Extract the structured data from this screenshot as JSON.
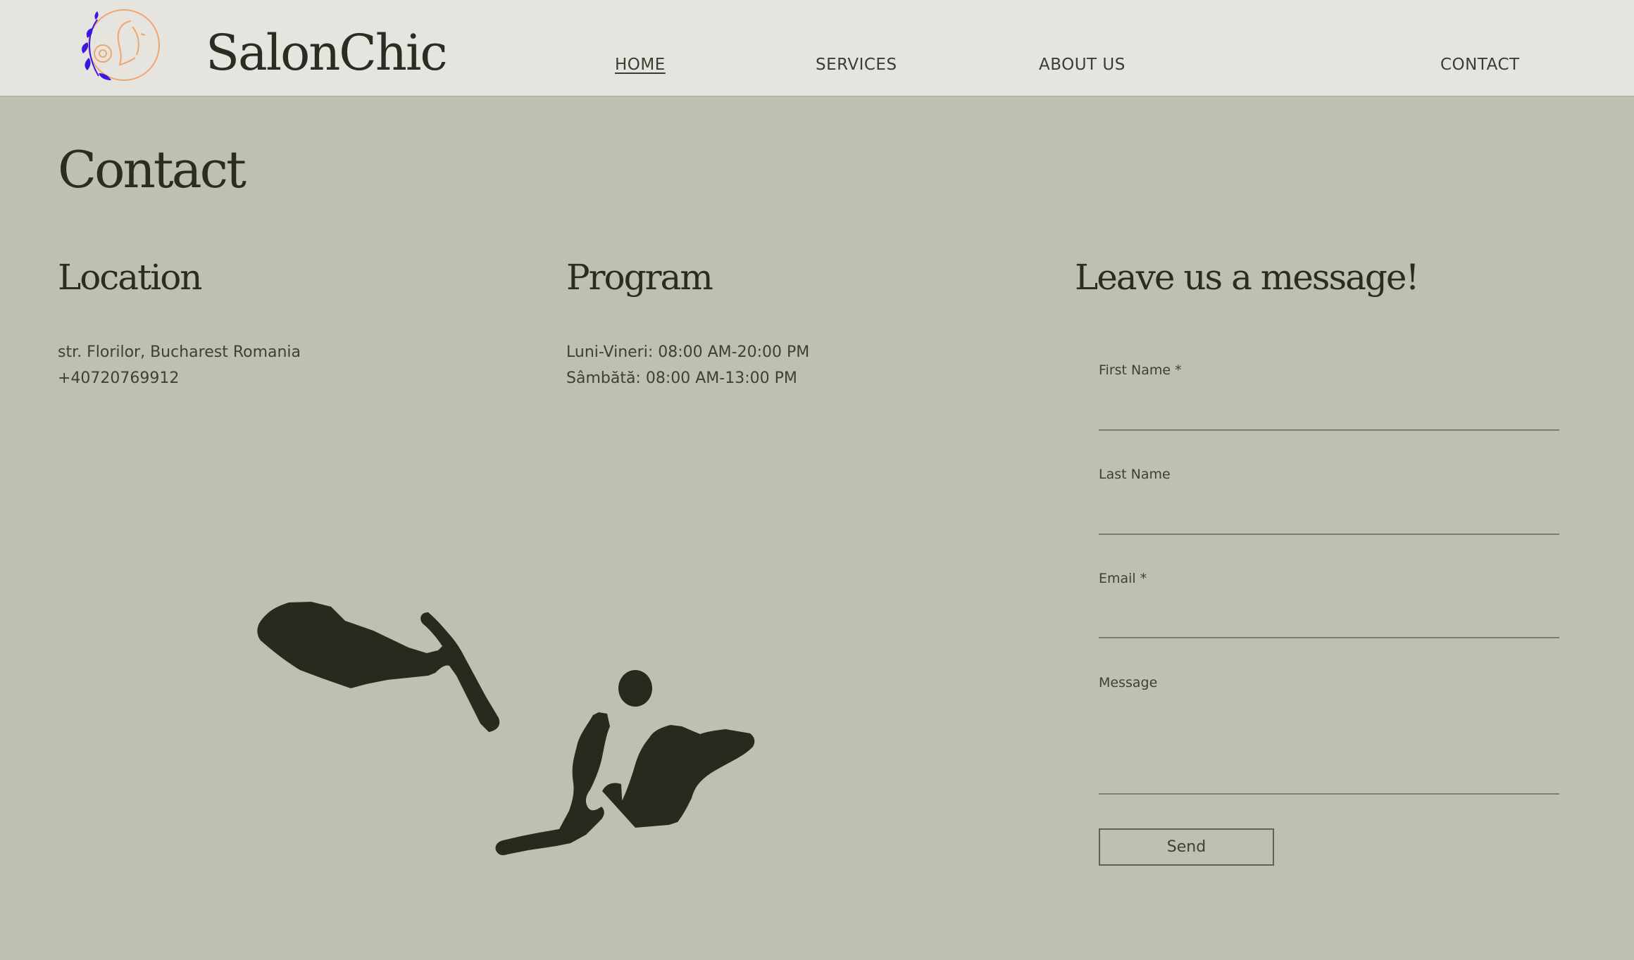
{
  "brand": {
    "name": "SalonChic"
  },
  "nav": {
    "home": "HOME",
    "services": "SERVICES",
    "about": "ABOUT US",
    "contact": "CONTACT"
  },
  "page": {
    "title": "Contact"
  },
  "location": {
    "title": "Location",
    "address": "str. Florilor, Bucharest Romania",
    "phone": "+40720769912"
  },
  "program": {
    "title": "Program",
    "weekdays": "Luni-Vineri: 08:00 AM-20:00 PM",
    "saturday": "Sâmbătă: 08:00 AM-13:00 PM"
  },
  "form": {
    "title": "Leave us a message!",
    "first_name_label": "First Name *",
    "last_name_label": "Last Name",
    "email_label": "Email *",
    "message_label": "Message",
    "send_label": "Send"
  },
  "colors": {
    "background": "#bfc0af",
    "header": "#e6e4de",
    "ink": "#262b1e",
    "logo_orange": "#f2a56b",
    "logo_blue": "#3b17e6"
  },
  "icons": {
    "logo": "woman-face-logo-icon",
    "decoration": "leaf-branch-illustration"
  }
}
